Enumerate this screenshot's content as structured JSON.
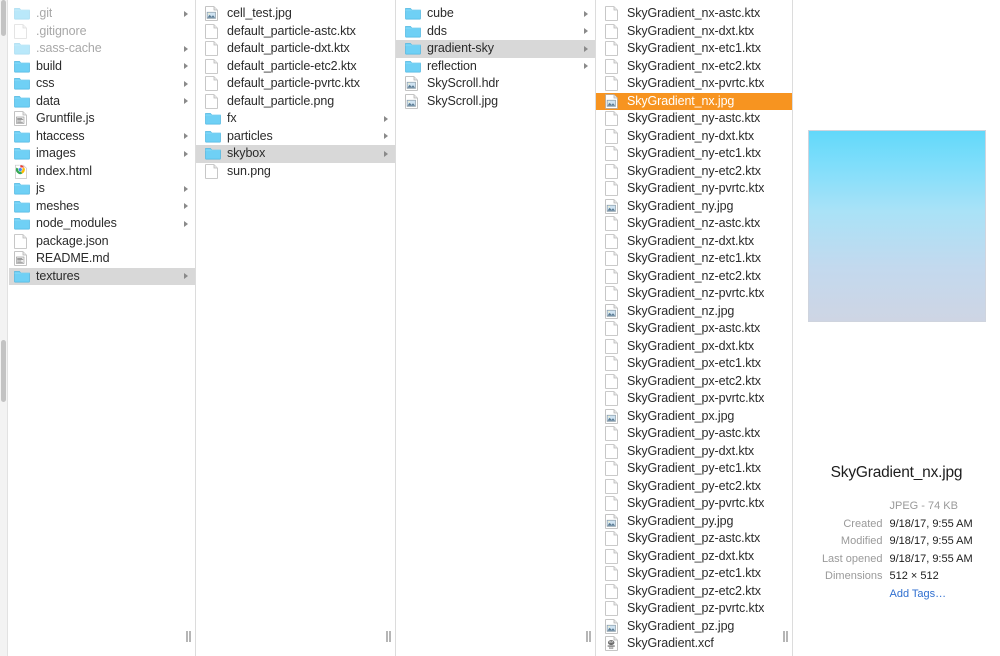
{
  "window": {
    "title": "Finder — textures / skybox / gradient-sky",
    "view_mode": "column",
    "selection_color": "#f79420",
    "inactive_selection_color": "#d8d8d8",
    "link_color": "#2f6fd0"
  },
  "columns": [
    {
      "name": "column-project-root",
      "items": [
        {
          "label": ".git",
          "icon": "folder-icon",
          "kind": "folder",
          "dimmed": true,
          "arrow": true,
          "selected": "none"
        },
        {
          "label": ".gitignore",
          "icon": "document-icon",
          "kind": "file",
          "dimmed": true,
          "arrow": false,
          "selected": "none"
        },
        {
          "label": ".sass-cache",
          "icon": "folder-icon",
          "kind": "folder",
          "dimmed": true,
          "arrow": true,
          "selected": "none"
        },
        {
          "label": "build",
          "icon": "folder-icon",
          "kind": "folder",
          "dimmed": false,
          "arrow": true,
          "selected": "none"
        },
        {
          "label": "css",
          "icon": "folder-icon",
          "kind": "folder",
          "dimmed": false,
          "arrow": true,
          "selected": "none"
        },
        {
          "label": "data",
          "icon": "folder-icon",
          "kind": "folder",
          "dimmed": false,
          "arrow": true,
          "selected": "none"
        },
        {
          "label": "Gruntfile.js",
          "icon": "script-file-icon",
          "kind": "file",
          "dimmed": false,
          "arrow": false,
          "selected": "none"
        },
        {
          "label": "htaccess",
          "icon": "folder-icon",
          "kind": "folder",
          "dimmed": false,
          "arrow": true,
          "selected": "none"
        },
        {
          "label": "images",
          "icon": "folder-icon",
          "kind": "folder",
          "dimmed": false,
          "arrow": true,
          "selected": "none"
        },
        {
          "label": "index.html",
          "icon": "chrome-html-icon",
          "kind": "file",
          "dimmed": false,
          "arrow": false,
          "selected": "none"
        },
        {
          "label": "js",
          "icon": "folder-icon",
          "kind": "folder",
          "dimmed": false,
          "arrow": true,
          "selected": "none"
        },
        {
          "label": "meshes",
          "icon": "folder-icon",
          "kind": "folder",
          "dimmed": false,
          "arrow": true,
          "selected": "none"
        },
        {
          "label": "node_modules",
          "icon": "folder-icon",
          "kind": "folder",
          "dimmed": false,
          "arrow": true,
          "selected": "none"
        },
        {
          "label": "package.json",
          "icon": "document-icon",
          "kind": "file",
          "dimmed": false,
          "arrow": false,
          "selected": "none"
        },
        {
          "label": "README.md",
          "icon": "script-file-icon",
          "kind": "file",
          "dimmed": false,
          "arrow": false,
          "selected": "none"
        },
        {
          "label": "textures",
          "icon": "folder-icon",
          "kind": "folder",
          "dimmed": false,
          "arrow": true,
          "selected": "gray"
        }
      ]
    },
    {
      "name": "column-textures",
      "items": [
        {
          "label": "cell_test.jpg",
          "icon": "image-file-icon",
          "kind": "file",
          "dimmed": false,
          "arrow": false,
          "selected": "none"
        },
        {
          "label": "default_particle-astc.ktx",
          "icon": "document-icon",
          "kind": "file",
          "dimmed": false,
          "arrow": false,
          "selected": "none"
        },
        {
          "label": "default_particle-dxt.ktx",
          "icon": "document-icon",
          "kind": "file",
          "dimmed": false,
          "arrow": false,
          "selected": "none"
        },
        {
          "label": "default_particle-etc2.ktx",
          "icon": "document-icon",
          "kind": "file",
          "dimmed": false,
          "arrow": false,
          "selected": "none"
        },
        {
          "label": "default_particle-pvrtc.ktx",
          "icon": "document-icon",
          "kind": "file",
          "dimmed": false,
          "arrow": false,
          "selected": "none"
        },
        {
          "label": "default_particle.png",
          "icon": "document-icon",
          "kind": "file",
          "dimmed": false,
          "arrow": false,
          "selected": "none"
        },
        {
          "label": "fx",
          "icon": "folder-icon",
          "kind": "folder",
          "dimmed": false,
          "arrow": true,
          "selected": "none"
        },
        {
          "label": "particles",
          "icon": "folder-icon",
          "kind": "folder",
          "dimmed": false,
          "arrow": true,
          "selected": "none"
        },
        {
          "label": "skybox",
          "icon": "folder-icon",
          "kind": "folder",
          "dimmed": false,
          "arrow": true,
          "selected": "gray"
        },
        {
          "label": "sun.png",
          "icon": "document-icon",
          "kind": "file",
          "dimmed": false,
          "arrow": false,
          "selected": "none"
        }
      ]
    },
    {
      "name": "column-skybox",
      "items": [
        {
          "label": "cube",
          "icon": "folder-icon",
          "kind": "folder",
          "dimmed": false,
          "arrow": true,
          "selected": "none"
        },
        {
          "label": "dds",
          "icon": "folder-icon",
          "kind": "folder",
          "dimmed": false,
          "arrow": true,
          "selected": "none"
        },
        {
          "label": "gradient-sky",
          "icon": "folder-icon",
          "kind": "folder",
          "dimmed": false,
          "arrow": true,
          "selected": "gray"
        },
        {
          "label": "reflection",
          "icon": "folder-icon",
          "kind": "folder",
          "dimmed": false,
          "arrow": true,
          "selected": "none"
        },
        {
          "label": "SkyScroll.hdr",
          "icon": "image-file-icon",
          "kind": "file",
          "dimmed": false,
          "arrow": false,
          "selected": "none"
        },
        {
          "label": "SkyScroll.jpg",
          "icon": "image-file-icon",
          "kind": "file",
          "dimmed": false,
          "arrow": false,
          "selected": "none"
        }
      ]
    },
    {
      "name": "column-gradient-sky",
      "items": [
        {
          "label": "SkyGradient_nx-astc.ktx",
          "icon": "document-icon",
          "kind": "file",
          "dimmed": false,
          "arrow": false,
          "selected": "none"
        },
        {
          "label": "SkyGradient_nx-dxt.ktx",
          "icon": "document-icon",
          "kind": "file",
          "dimmed": false,
          "arrow": false,
          "selected": "none"
        },
        {
          "label": "SkyGradient_nx-etc1.ktx",
          "icon": "document-icon",
          "kind": "file",
          "dimmed": false,
          "arrow": false,
          "selected": "none"
        },
        {
          "label": "SkyGradient_nx-etc2.ktx",
          "icon": "document-icon",
          "kind": "file",
          "dimmed": false,
          "arrow": false,
          "selected": "none"
        },
        {
          "label": "SkyGradient_nx-pvrtc.ktx",
          "icon": "document-icon",
          "kind": "file",
          "dimmed": false,
          "arrow": false,
          "selected": "none"
        },
        {
          "label": "SkyGradient_nx.jpg",
          "icon": "image-file-icon",
          "kind": "file",
          "dimmed": false,
          "arrow": false,
          "selected": "orange"
        },
        {
          "label": "SkyGradient_ny-astc.ktx",
          "icon": "document-icon",
          "kind": "file",
          "dimmed": false,
          "arrow": false,
          "selected": "none"
        },
        {
          "label": "SkyGradient_ny-dxt.ktx",
          "icon": "document-icon",
          "kind": "file",
          "dimmed": false,
          "arrow": false,
          "selected": "none"
        },
        {
          "label": "SkyGradient_ny-etc1.ktx",
          "icon": "document-icon",
          "kind": "file",
          "dimmed": false,
          "arrow": false,
          "selected": "none"
        },
        {
          "label": "SkyGradient_ny-etc2.ktx",
          "icon": "document-icon",
          "kind": "file",
          "dimmed": false,
          "arrow": false,
          "selected": "none"
        },
        {
          "label": "SkyGradient_ny-pvrtc.ktx",
          "icon": "document-icon",
          "kind": "file",
          "dimmed": false,
          "arrow": false,
          "selected": "none"
        },
        {
          "label": "SkyGradient_ny.jpg",
          "icon": "image-file-icon",
          "kind": "file",
          "dimmed": false,
          "arrow": false,
          "selected": "none"
        },
        {
          "label": "SkyGradient_nz-astc.ktx",
          "icon": "document-icon",
          "kind": "file",
          "dimmed": false,
          "arrow": false,
          "selected": "none"
        },
        {
          "label": "SkyGradient_nz-dxt.ktx",
          "icon": "document-icon",
          "kind": "file",
          "dimmed": false,
          "arrow": false,
          "selected": "none"
        },
        {
          "label": "SkyGradient_nz-etc1.ktx",
          "icon": "document-icon",
          "kind": "file",
          "dimmed": false,
          "arrow": false,
          "selected": "none"
        },
        {
          "label": "SkyGradient_nz-etc2.ktx",
          "icon": "document-icon",
          "kind": "file",
          "dimmed": false,
          "arrow": false,
          "selected": "none"
        },
        {
          "label": "SkyGradient_nz-pvrtc.ktx",
          "icon": "document-icon",
          "kind": "file",
          "dimmed": false,
          "arrow": false,
          "selected": "none"
        },
        {
          "label": "SkyGradient_nz.jpg",
          "icon": "image-file-icon",
          "kind": "file",
          "dimmed": false,
          "arrow": false,
          "selected": "none"
        },
        {
          "label": "SkyGradient_px-astc.ktx",
          "icon": "document-icon",
          "kind": "file",
          "dimmed": false,
          "arrow": false,
          "selected": "none"
        },
        {
          "label": "SkyGradient_px-dxt.ktx",
          "icon": "document-icon",
          "kind": "file",
          "dimmed": false,
          "arrow": false,
          "selected": "none"
        },
        {
          "label": "SkyGradient_px-etc1.ktx",
          "icon": "document-icon",
          "kind": "file",
          "dimmed": false,
          "arrow": false,
          "selected": "none"
        },
        {
          "label": "SkyGradient_px-etc2.ktx",
          "icon": "document-icon",
          "kind": "file",
          "dimmed": false,
          "arrow": false,
          "selected": "none"
        },
        {
          "label": "SkyGradient_px-pvrtc.ktx",
          "icon": "document-icon",
          "kind": "file",
          "dimmed": false,
          "arrow": false,
          "selected": "none"
        },
        {
          "label": "SkyGradient_px.jpg",
          "icon": "image-file-icon",
          "kind": "file",
          "dimmed": false,
          "arrow": false,
          "selected": "none"
        },
        {
          "label": "SkyGradient_py-astc.ktx",
          "icon": "document-icon",
          "kind": "file",
          "dimmed": false,
          "arrow": false,
          "selected": "none"
        },
        {
          "label": "SkyGradient_py-dxt.ktx",
          "icon": "document-icon",
          "kind": "file",
          "dimmed": false,
          "arrow": false,
          "selected": "none"
        },
        {
          "label": "SkyGradient_py-etc1.ktx",
          "icon": "document-icon",
          "kind": "file",
          "dimmed": false,
          "arrow": false,
          "selected": "none"
        },
        {
          "label": "SkyGradient_py-etc2.ktx",
          "icon": "document-icon",
          "kind": "file",
          "dimmed": false,
          "arrow": false,
          "selected": "none"
        },
        {
          "label": "SkyGradient_py-pvrtc.ktx",
          "icon": "document-icon",
          "kind": "file",
          "dimmed": false,
          "arrow": false,
          "selected": "none"
        },
        {
          "label": "SkyGradient_py.jpg",
          "icon": "image-file-icon",
          "kind": "file",
          "dimmed": false,
          "arrow": false,
          "selected": "none"
        },
        {
          "label": "SkyGradient_pz-astc.ktx",
          "icon": "document-icon",
          "kind": "file",
          "dimmed": false,
          "arrow": false,
          "selected": "none"
        },
        {
          "label": "SkyGradient_pz-dxt.ktx",
          "icon": "document-icon",
          "kind": "file",
          "dimmed": false,
          "arrow": false,
          "selected": "none"
        },
        {
          "label": "SkyGradient_pz-etc1.ktx",
          "icon": "document-icon",
          "kind": "file",
          "dimmed": false,
          "arrow": false,
          "selected": "none"
        },
        {
          "label": "SkyGradient_pz-etc2.ktx",
          "icon": "document-icon",
          "kind": "file",
          "dimmed": false,
          "arrow": false,
          "selected": "none"
        },
        {
          "label": "SkyGradient_pz-pvrtc.ktx",
          "icon": "document-icon",
          "kind": "file",
          "dimmed": false,
          "arrow": false,
          "selected": "none"
        },
        {
          "label": "SkyGradient_pz.jpg",
          "icon": "image-file-icon",
          "kind": "file",
          "dimmed": false,
          "arrow": false,
          "selected": "none"
        },
        {
          "label": "SkyGradient.xcf",
          "icon": "gimp-file-icon",
          "kind": "file",
          "dimmed": false,
          "arrow": false,
          "selected": "none"
        }
      ]
    }
  ],
  "preview": {
    "filename": "SkyGradient_nx.jpg",
    "thumbnail": {
      "name": "sky-gradient-thumbnail",
      "gradient_top": "#62d8fa",
      "gradient_bottom": "#ced5e4"
    },
    "kind_and_size": "JPEG - 74 KB",
    "metadata": [
      {
        "key": "Created",
        "value": "9/18/17, 9:55 AM"
      },
      {
        "key": "Modified",
        "value": "9/18/17, 9:55 AM"
      },
      {
        "key": "Last opened",
        "value": "9/18/17, 9:55 AM"
      },
      {
        "key": "Dimensions",
        "value": "512 × 512"
      }
    ],
    "add_tags_label": "Add Tags…"
  }
}
